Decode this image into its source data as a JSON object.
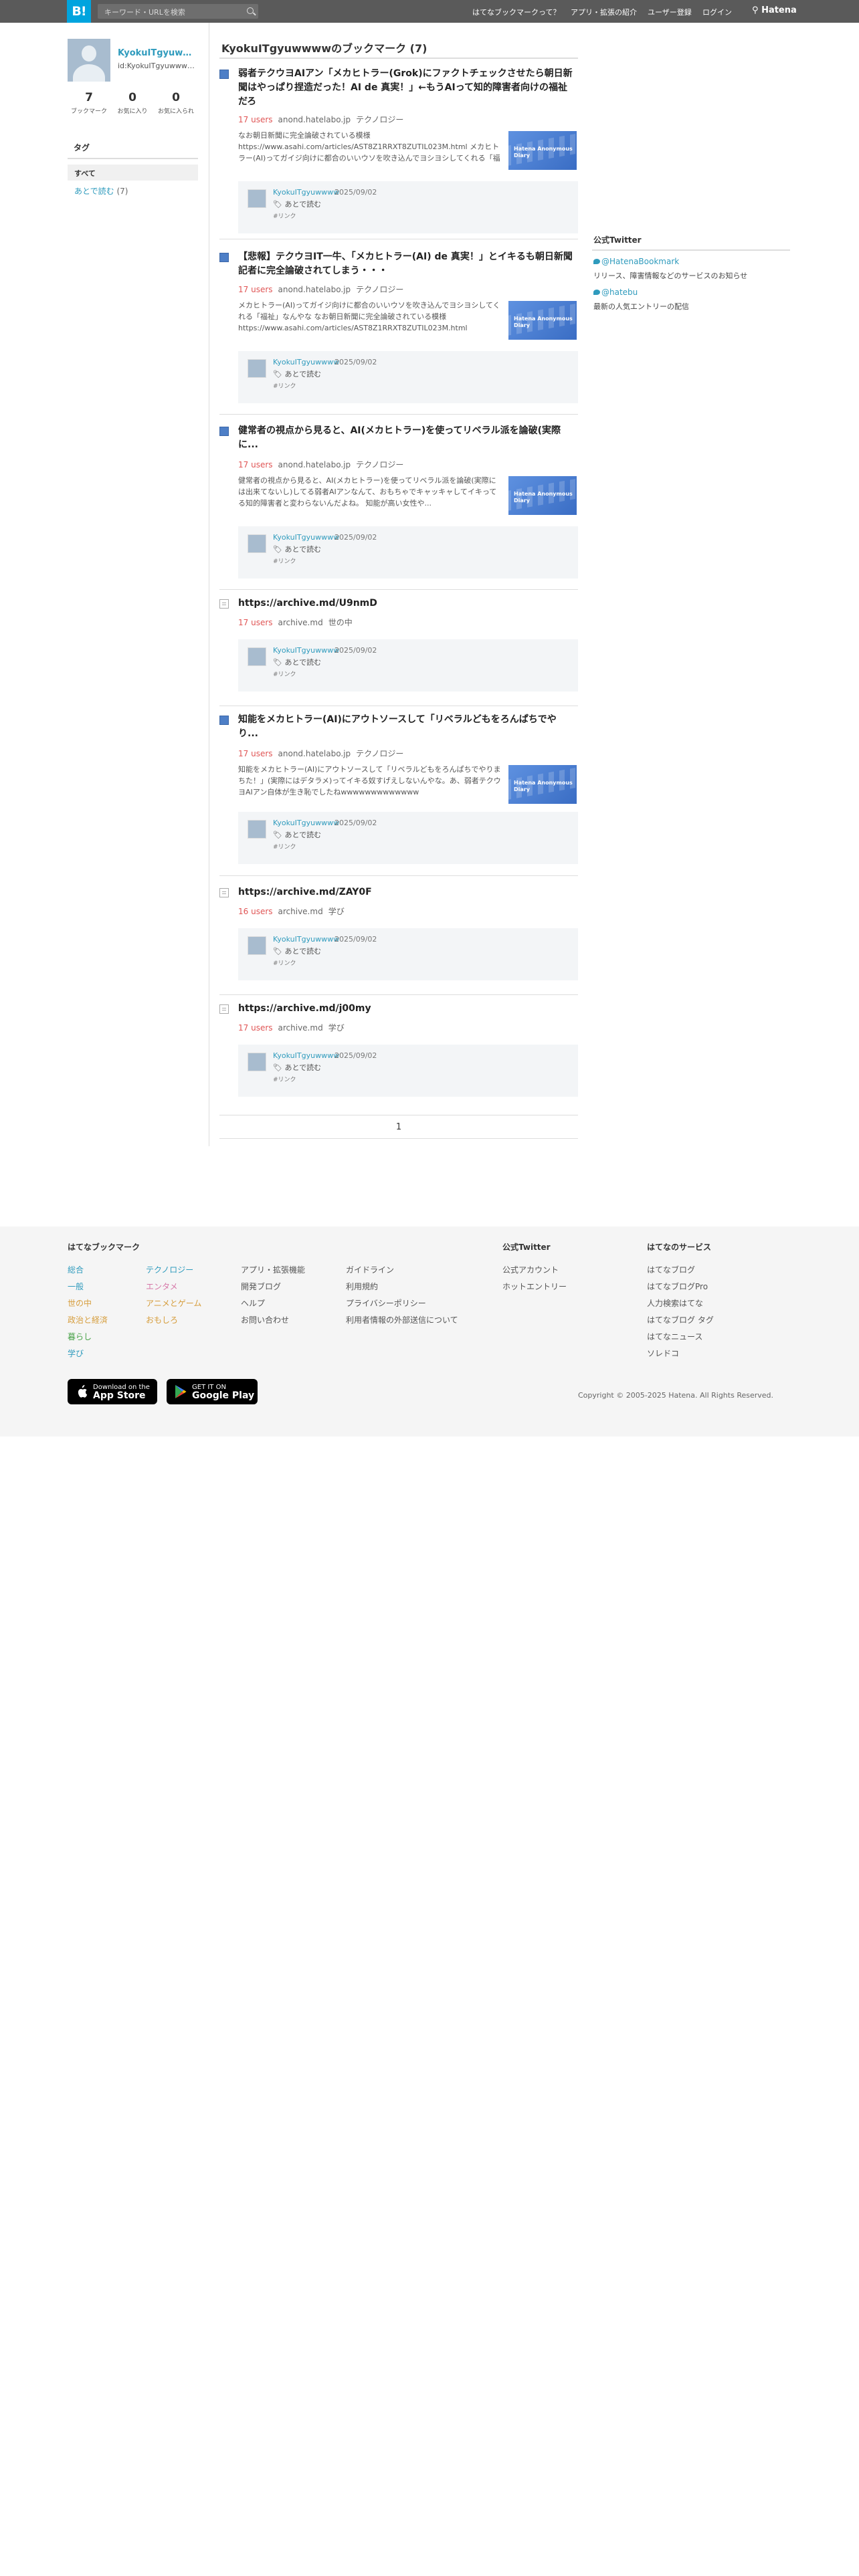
{
  "header": {
    "logo": "B!",
    "search_placeholder": "キーワード・URLを検索",
    "nav": [
      "はてなブックマークって？",
      "アプリ・拡張の紹介",
      "ユーザー登録",
      "ログイン"
    ],
    "brand": "Hatena"
  },
  "profile": {
    "name": "KyokuITgyuwwwww",
    "id": "id:KyokuITgyuwwwww",
    "stats": [
      {
        "value": "7",
        "label": "ブックマーク"
      },
      {
        "value": "0",
        "label": "お気に入り"
      },
      {
        "value": "0",
        "label": "お気に入られ"
      }
    ],
    "tags_heading": "タグ",
    "tag_all": "すべて",
    "tag_later": "あとで読む",
    "tag_later_count": "(7)"
  },
  "main": {
    "title": "KyokuITgyuwwwwのブックマーク (7)",
    "entries": [
      {
        "title": "弱者テクウヨAIアン「メカヒトラー(Grok)にファクトチェックさせたら朝日新聞はやっぱり捏造だった！AI de 真実！」←もうAIって知的障害者向けの福祉だろ",
        "users": "17 users",
        "domain": "anond.hatelabo.jp",
        "category": "テクノロジー",
        "desc": "なお朝日新聞に完全論破されている模様 https://www.asahi.com/articles/AST8Z1RRXT8ZUTIL023M.html メカヒトラー(AI)ってガイジ向けに都合のいいウソを吹き込んでヨシヨシしてくれる「福祉」なんやな…",
        "thumb": "Hatena Anonymous Diary",
        "user": "KyokuITgyuwwww",
        "date": "2025/09/02",
        "tag": "あとで読む",
        "link": "#リンク"
      },
      {
        "title": "【悲報】テクウヨIT一牛、「メカヒトラー(AI) de 真実！」とイキるも朝日新聞記者に完全論破されてしまう・・・",
        "users": "17 users",
        "domain": "anond.hatelabo.jp",
        "category": "テクノロジー",
        "desc": "メカヒトラー(AI)ってガイジ向けに都合のいいウソを吹き込んでヨシヨシしてくれる「福祉」なんやな なお朝日新聞に完全論破されている模様 https://www.asahi.com/articles/AST8Z1RRXT8ZUTIL023M.html",
        "thumb": "Hatena Anonymous Diary",
        "user": "KyokuITgyuwwww",
        "date": "2025/09/02",
        "tag": "あとで読む",
        "link": "#リンク"
      },
      {
        "title": "健常者の視点から見ると、AI(メカヒトラー)を使ってリベラル派を論破(実際に...",
        "users": "17 users",
        "domain": "anond.hatelabo.jp",
        "category": "テクノロジー",
        "desc": "健常者の視点から見ると、AI(メカヒトラー)を使ってリベラル派を論破(実際には出来てないし)してる弱者AIアンなんて、おもちゃでキャッキャしてイキってる知的障害者と変わらないんだよね。 知能が高い女性や...",
        "thumb": "Hatena Anonymous Diary",
        "user": "KyokuITgyuwwww",
        "date": "2025/09/02",
        "tag": "あとで読む",
        "link": "#リンク"
      },
      {
        "title": "https://archive.md/U9nmD",
        "users": "17 users",
        "domain": "archive.md",
        "category": "世の中",
        "desc": "",
        "thumb": "",
        "user": "KyokuITgyuwwww",
        "date": "2025/09/02",
        "tag": "あとで読む",
        "link": "#リンク"
      },
      {
        "title": "知能をメカヒトラー(AI)にアウトソースして「リベラルどもをろんぱちでやり...",
        "users": "17 users",
        "domain": "anond.hatelabo.jp",
        "category": "テクノロジー",
        "desc": "知能をメカヒトラー(AI)にアウトソースして「リベラルどもをろんぱちでやりまちた！」(実際にはデタラメ)ってイキる奴すげえしないんやな。あ、弱者テクウヨAIアン自体が生き恥でしたねwwwwwwwwwwwww",
        "thumb": "Hatena Anonymous Diary",
        "user": "KyokuITgyuwwww",
        "date": "2025/09/02",
        "tag": "あとで読む",
        "link": "#リンク"
      },
      {
        "title": "https://archive.md/ZAY0F",
        "users": "16 users",
        "domain": "archive.md",
        "category": "学び",
        "desc": "",
        "thumb": "",
        "user": "KyokuITgyuwwww",
        "date": "2025/09/02",
        "tag": "あとで読む",
        "link": "#リンク"
      },
      {
        "title": "https://archive.md/j00my",
        "users": "17 users",
        "domain": "archive.md",
        "category": "学び",
        "desc": "",
        "thumb": "",
        "user": "KyokuITgyuwwww",
        "date": "2025/09/02",
        "tag": "あとで読む",
        "link": "#リンク"
      }
    ],
    "page": "1"
  },
  "sidebar": {
    "heading": "公式Twitter",
    "accounts": [
      {
        "handle": "@HatenaBookmark",
        "desc": "リリース、障害情報などのサービスのお知らせ"
      },
      {
        "handle": "@hatebu",
        "desc": "最新の人気エントリーの配信"
      }
    ]
  },
  "footer": {
    "col1_heading": "はてなブックマーク",
    "cats_a": [
      "総合",
      "一般",
      "世の中",
      "政治と経済",
      "暮らし",
      "学び"
    ],
    "cats_b": [
      "テクノロジー",
      "エンタメ",
      "アニメとゲーム",
      "おもしろ"
    ],
    "links_c": [
      "アプリ・拡張機能",
      "開発ブログ",
      "ヘルプ",
      "お問い合わせ"
    ],
    "links_d": [
      "ガイドライン",
      "利用規約",
      "プライバシーポリシー",
      "利用者情報の外部送信について"
    ],
    "twitter_heading": "公式Twitter",
    "twitter_links": [
      "公式アカウント",
      "ホットエントリー"
    ],
    "services_heading": "はてなのサービス",
    "services": [
      "はてなブログ",
      "はてなブログPro",
      "人力検索はてな",
      "はてなブログ タグ",
      "はてなニュース",
      "ソレドコ"
    ],
    "appstore_small": "Download on the",
    "appstore": "App Store",
    "googleplay_small": "GET IT ON",
    "googleplay": "Google Play",
    "copyright": "Copyright © 2005-2025 Hatena. All Rights Reserved."
  }
}
